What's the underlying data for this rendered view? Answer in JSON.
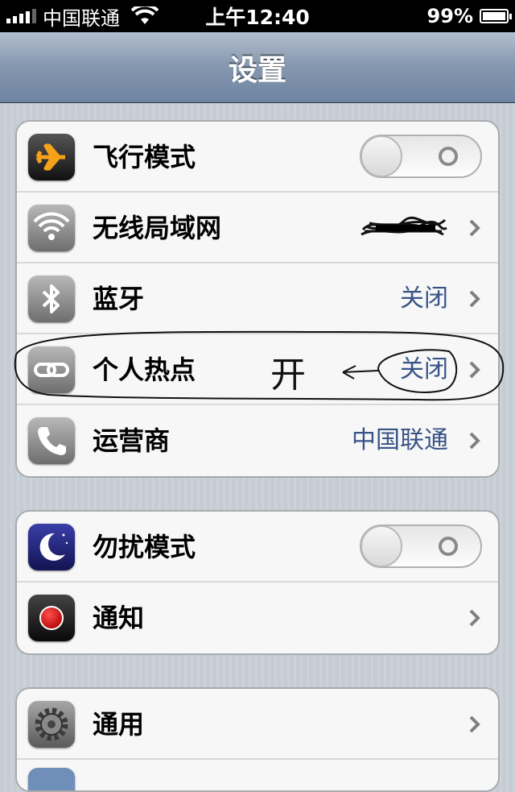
{
  "status_bar": {
    "carrier": "中国联通",
    "time": "上午12:40",
    "battery": "99%",
    "battery_level": 0.99
  },
  "nav": {
    "title": "设置"
  },
  "groups": [
    {
      "rows": [
        {
          "label": "飞行模式",
          "icon": "airplane-icon",
          "type": "toggle",
          "on": false
        },
        {
          "label": "无线局域网",
          "icon": "wifi-icon",
          "type": "value",
          "value": ""
        },
        {
          "label": "蓝牙",
          "icon": "bluetooth-icon",
          "type": "value",
          "value": "关闭"
        },
        {
          "label": "个人热点",
          "icon": "hotspot-icon",
          "type": "value",
          "value": "关闭"
        },
        {
          "label": "运营商",
          "icon": "phone-icon",
          "type": "value",
          "value": "中国联通"
        }
      ]
    },
    {
      "rows": [
        {
          "label": "勿扰模式",
          "icon": "moon-icon",
          "type": "toggle",
          "on": false
        },
        {
          "label": "通知",
          "icon": "notification-icon",
          "type": "disclosure"
        }
      ]
    },
    {
      "rows": [
        {
          "label": "通用",
          "icon": "gear-icon",
          "type": "disclosure"
        }
      ]
    }
  ],
  "annotation": {
    "text": "开"
  },
  "colors": {
    "value_blue": "#385487",
    "nav_top": "#b2bfd0",
    "nav_bottom": "#6e84a2"
  }
}
